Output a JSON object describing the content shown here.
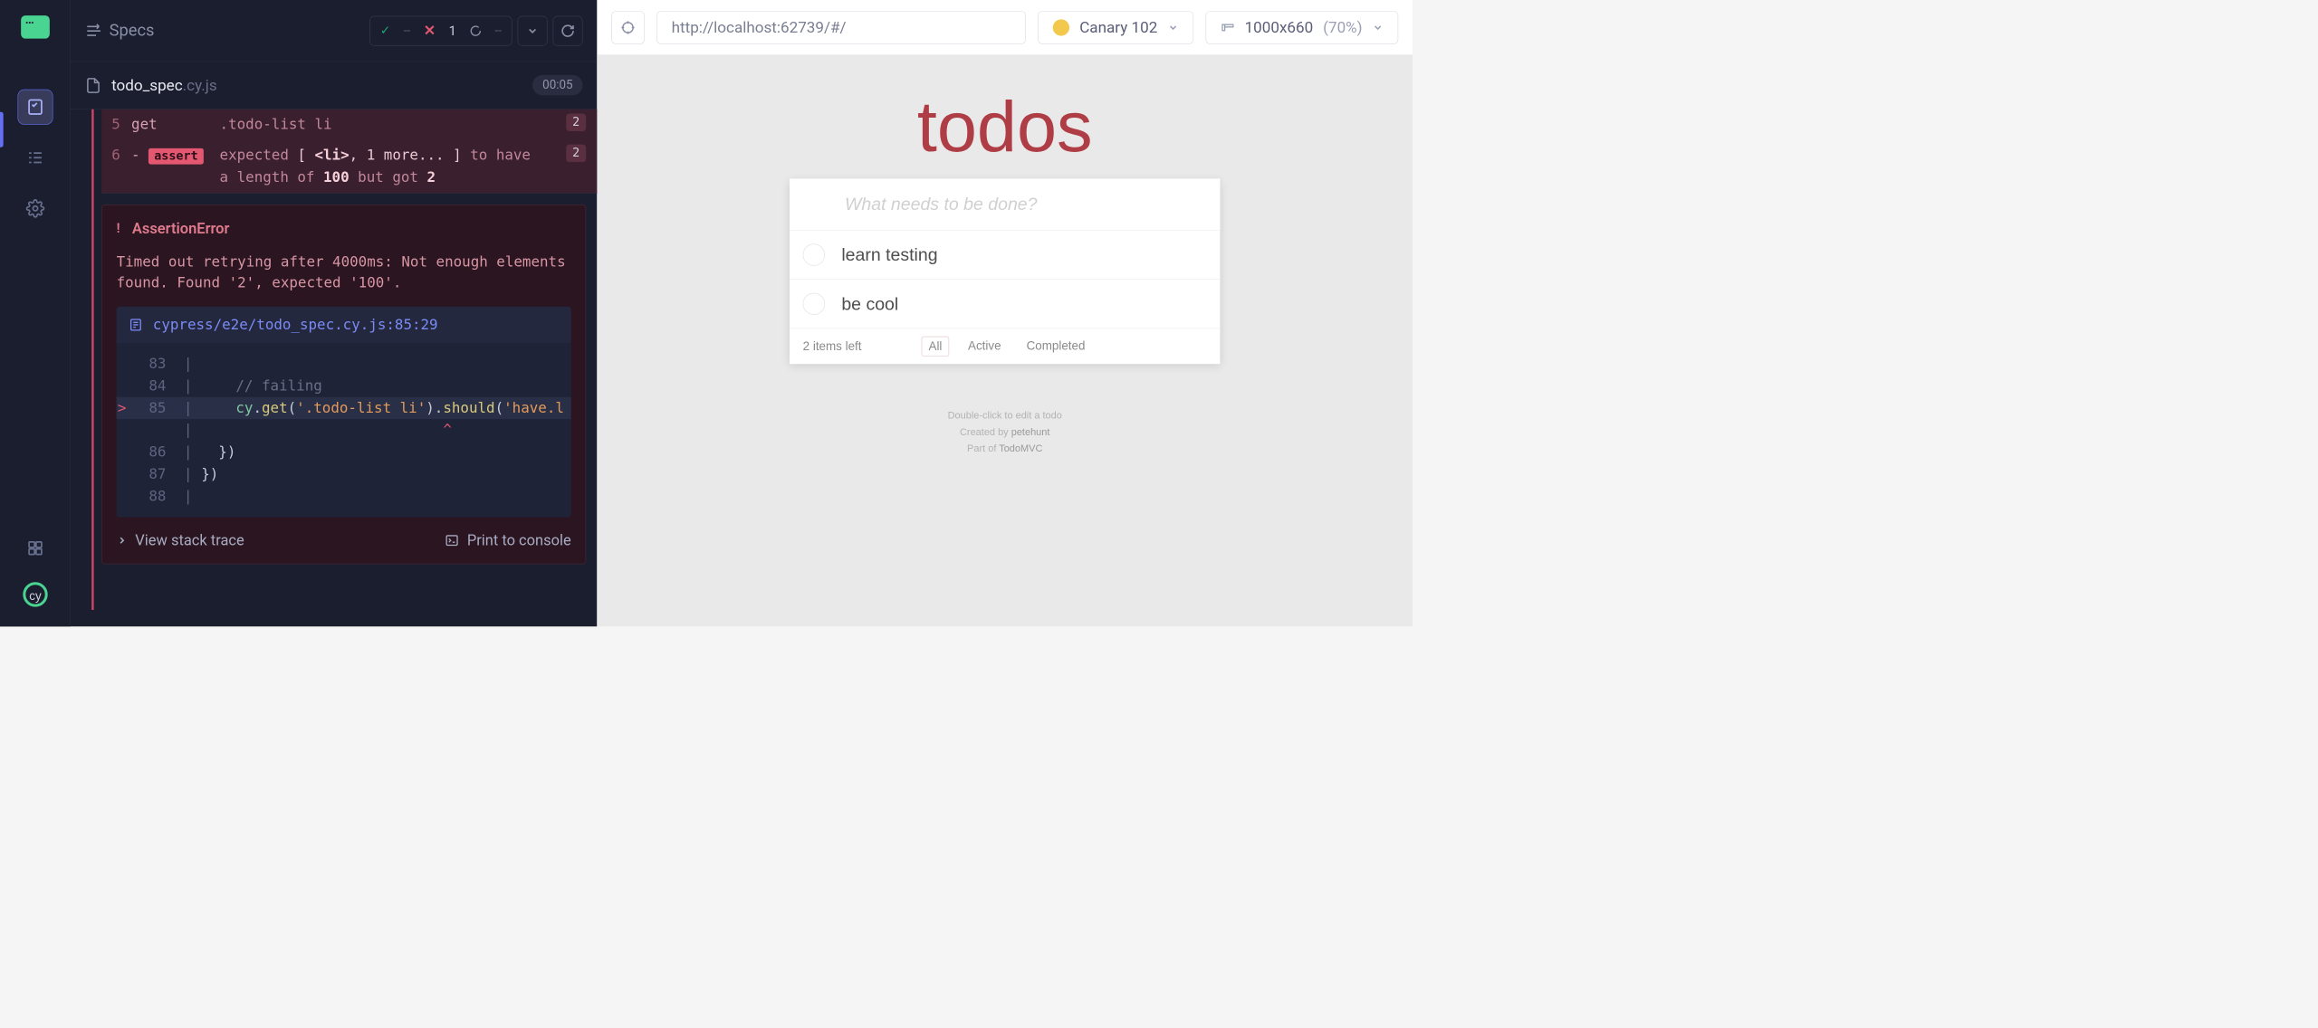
{
  "leftNav": {},
  "header": {
    "specs_label": "Specs",
    "passed": "--",
    "failed": "1",
    "pending": "--"
  },
  "file": {
    "name": "todo_spec",
    "ext": ".cy.js",
    "timer": "00:05"
  },
  "commands": {
    "row5": {
      "num": "5",
      "name": "get",
      "args": ".todo-list li",
      "badge": "2"
    },
    "row6": {
      "num": "6",
      "dash": "-",
      "tag": "assert",
      "l1_pre": "expected ",
      "l1_br1": "[ ",
      "l1_li": "<li>",
      "l1_more": ", 1 more... ",
      "l1_br2": "] ",
      "l1_post": "to have",
      "l2_pre": "a length of ",
      "l2_a": "100",
      "l2_mid": " but got ",
      "l2_b": "2",
      "badge": "2"
    }
  },
  "error": {
    "title": "AssertionError",
    "msg": "Timed out retrying after 4000ms: Not enough elements found. Found '2', expected '100'.",
    "file": "cypress/e2e/todo_spec.cy.js:85:29",
    "lines": {
      "83": {
        "n": "83",
        "txt": ""
      },
      "84": {
        "n": "84",
        "txt": "// failing"
      },
      "85": {
        "n": "85"
      },
      "caret": {
        "n": ""
      },
      "86": {
        "n": "86",
        "txt": "})"
      },
      "87": {
        "n": "87",
        "txt": "})"
      },
      "88": {
        "n": "88",
        "txt": ""
      }
    },
    "view_stack": "View stack trace",
    "print_console": "Print to console"
  },
  "browser": {
    "url": "http://localhost:62739/#/",
    "name": "Canary 102",
    "viewport_dims": "1000x660",
    "viewport_scale": "(70%)"
  },
  "todo": {
    "title": "todos",
    "placeholder": "What needs to be done?",
    "items": {
      "0": "learn testing",
      "1": "be cool"
    },
    "count": "2 items left",
    "filters": {
      "all": "All",
      "active": "Active",
      "completed": "Completed"
    },
    "foot1": "Double-click to edit a todo",
    "foot2a": "Created by ",
    "foot2b": "petehunt",
    "foot3a": "Part of ",
    "foot3b": "TodoMVC"
  }
}
